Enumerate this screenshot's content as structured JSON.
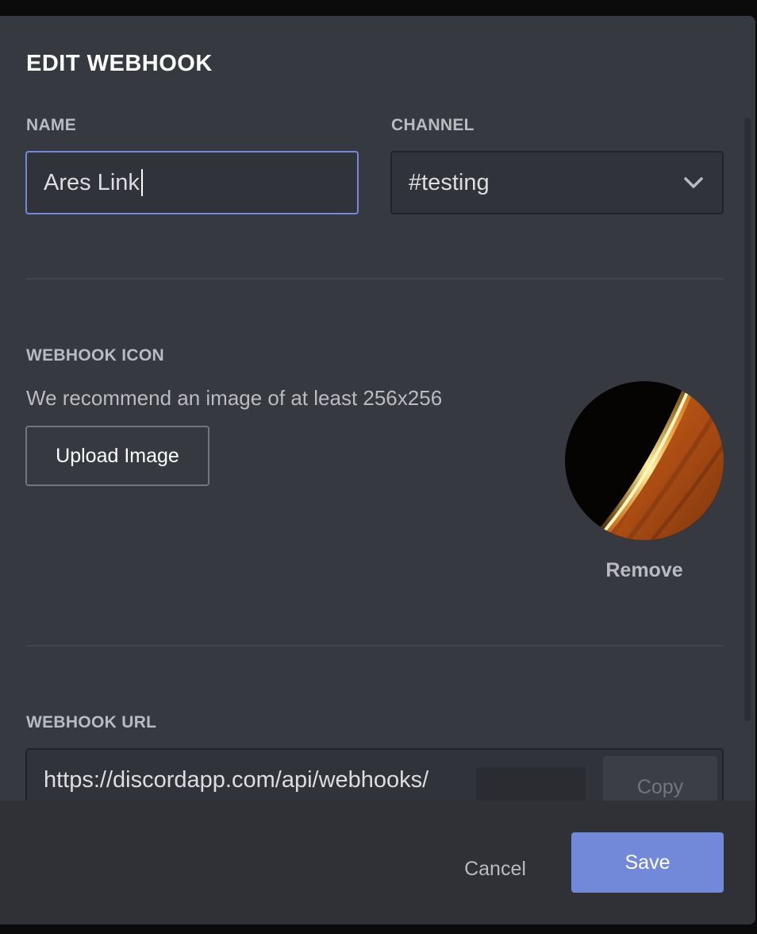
{
  "dialog": {
    "title": "EDIT WEBHOOK"
  },
  "name_field": {
    "label": "NAME",
    "value": "Ares Link"
  },
  "channel_field": {
    "label": "CHANNEL",
    "value": "#testing",
    "icon": "chevron-down-icon"
  },
  "icon_section": {
    "label": "WEBHOOK ICON",
    "hint": "We recommend an image of at least 256x256",
    "upload_label": "Upload Image",
    "remove_label": "Remove"
  },
  "url_section": {
    "label": "WEBHOOK URL",
    "value": "https://discordapp.com/api/webhooks/",
    "copy_label": "Copy"
  },
  "footer": {
    "cancel_label": "Cancel",
    "save_label": "Save"
  },
  "colors": {
    "accent": "#7289da",
    "background": "#36393f",
    "footer": "#2f3136"
  }
}
